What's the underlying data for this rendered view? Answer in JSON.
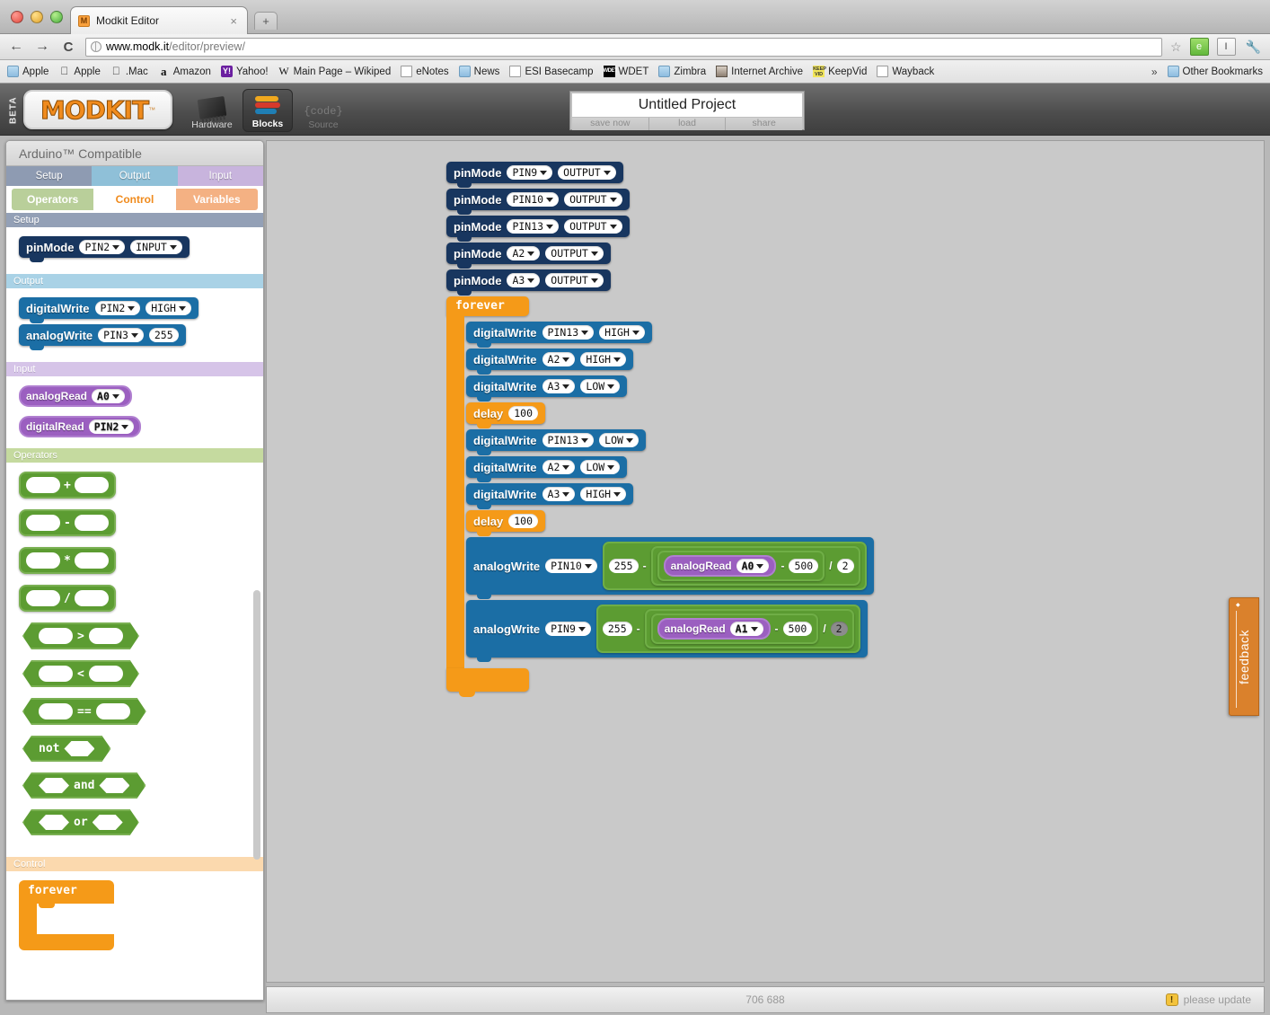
{
  "browser": {
    "tab_title": "Modkit Editor",
    "tab_favicon": "M",
    "close_label": "×",
    "newtab_label": "+",
    "back_icon": "←",
    "forward_icon": "→",
    "reload_icon": "C",
    "url_domain": "www.modk.it",
    "url_path": "/editor/preview/",
    "star_icon": "☆",
    "ext_evernote": "e",
    "ext_textcursor": "I",
    "wrench_icon": "🔧",
    "bookmarks": [
      {
        "label": "Apple",
        "icon": "folder-icon"
      },
      {
        "label": "Apple",
        "icon": "apple-icon"
      },
      {
        "label": ".Mac",
        "icon": "apple-icon"
      },
      {
        "label": "Amazon",
        "icon": "amazon-icon"
      },
      {
        "label": "Yahoo!",
        "icon": "yahoo-icon"
      },
      {
        "label": "Main Page – Wikiped",
        "icon": "wikipedia-icon"
      },
      {
        "label": "eNotes",
        "icon": "page-icon"
      },
      {
        "label": "News",
        "icon": "folder-icon"
      },
      {
        "label": "ESI Basecamp",
        "icon": "page-icon"
      },
      {
        "label": "WDET",
        "icon": "wdet-icon"
      },
      {
        "label": "Zimbra",
        "icon": "folder-icon"
      },
      {
        "label": "Internet Archive",
        "icon": "archive-icon"
      },
      {
        "label": "KeepVid",
        "icon": "keepvid-icon"
      },
      {
        "label": "Wayback",
        "icon": "page-icon"
      }
    ],
    "overflow_chevron": "»",
    "other_bookmarks": "Other Bookmarks"
  },
  "header": {
    "beta": "BETA",
    "logo": "MODKIT",
    "logo_tm": "™",
    "modes": [
      {
        "label": "Hardware",
        "icon": "chip-icon",
        "state": "normal"
      },
      {
        "label": "Blocks",
        "icon": "blocks-icon",
        "state": "active"
      },
      {
        "label": "Source",
        "icon": "code-icon",
        "state": "dim"
      }
    ],
    "code_icon_text": "{code}",
    "project": {
      "title": "Untitled Project",
      "actions": [
        "save now",
        "load",
        "share"
      ]
    },
    "transport": [
      "play-icon",
      "pause-icon",
      "stop-icon"
    ]
  },
  "sidebar": {
    "title": "Arduino™ Compatible",
    "tabs_row1": [
      {
        "label": "Setup",
        "color": "#8e9bb2"
      },
      {
        "label": "Output",
        "color": "#8fc0d8"
      },
      {
        "label": "Input",
        "color": "#c8b4dd"
      }
    ],
    "tabs_row2": [
      {
        "label": "Operators",
        "color": "#b9cf9a",
        "active": false
      },
      {
        "label": "Control",
        "color": "#ffffff",
        "active": true
      },
      {
        "label": "Variables",
        "color": "#f4b183",
        "active": false
      }
    ],
    "sections": [
      {
        "name": "Setup"
      },
      {
        "name": "Output"
      },
      {
        "name": "Input"
      },
      {
        "name": "Operators"
      },
      {
        "name": "Control"
      }
    ],
    "palette": {
      "setup_pinmode": {
        "label": "pinMode",
        "pin": "PIN2",
        "mode": "INPUT"
      },
      "output_digitalwrite": {
        "label": "digitalWrite",
        "pin": "PIN2",
        "value": "HIGH"
      },
      "output_analogwrite": {
        "label": "analogWrite",
        "pin": "PIN3",
        "value": "255"
      },
      "input_analogread": {
        "label": "analogRead",
        "pin": "A0"
      },
      "input_digitalread": {
        "label": "digitalRead",
        "pin": "PIN2"
      },
      "operators": [
        "+",
        "-",
        "*",
        "/",
        ">",
        "<",
        "==",
        "not",
        "and",
        "or"
      ],
      "control_forever": "forever"
    }
  },
  "canvas": {
    "pinmodes": [
      {
        "label": "pinMode",
        "pin": "PIN9",
        "mode": "OUTPUT"
      },
      {
        "label": "pinMode",
        "pin": "PIN10",
        "mode": "OUTPUT"
      },
      {
        "label": "pinMode",
        "pin": "PIN13",
        "mode": "OUTPUT"
      },
      {
        "label": "pinMode",
        "pin": "A2",
        "mode": "OUTPUT"
      },
      {
        "label": "pinMode",
        "pin": "A3",
        "mode": "OUTPUT"
      }
    ],
    "forever_label": "forever",
    "loop_body": [
      {
        "type": "digitalWrite",
        "label": "digitalWrite",
        "pin": "PIN13",
        "value": "HIGH"
      },
      {
        "type": "digitalWrite",
        "label": "digitalWrite",
        "pin": "A2",
        "value": "HIGH"
      },
      {
        "type": "digitalWrite",
        "label": "digitalWrite",
        "pin": "A3",
        "value": "LOW"
      },
      {
        "type": "delay",
        "label": "delay",
        "value": "100"
      },
      {
        "type": "digitalWrite",
        "label": "digitalWrite",
        "pin": "PIN13",
        "value": "LOW"
      },
      {
        "type": "digitalWrite",
        "label": "digitalWrite",
        "pin": "A2",
        "value": "LOW"
      },
      {
        "type": "digitalWrite",
        "label": "digitalWrite",
        "pin": "A3",
        "value": "HIGH"
      },
      {
        "type": "delay",
        "label": "delay",
        "value": "100"
      }
    ],
    "analog_writes": [
      {
        "label": "analogWrite",
        "pin": "PIN10",
        "left": "255",
        "op_outer": "-",
        "op_div": "/",
        "divisor": "2",
        "read_label": "analogRead",
        "read_pin": "A0",
        "op_inner": "-",
        "offset": "500",
        "divisor_selected": false
      },
      {
        "label": "analogWrite",
        "pin": "PIN9",
        "left": "255",
        "op_outer": "-",
        "op_div": "/",
        "divisor": "2",
        "read_label": "analogRead",
        "read_pin": "A1",
        "op_inner": "-",
        "offset": "500",
        "divisor_selected": true
      }
    ]
  },
  "feedback_tab": "feedback",
  "statusbar": {
    "coords": "706 688",
    "update_text": "please update",
    "warn_icon": "!"
  }
}
